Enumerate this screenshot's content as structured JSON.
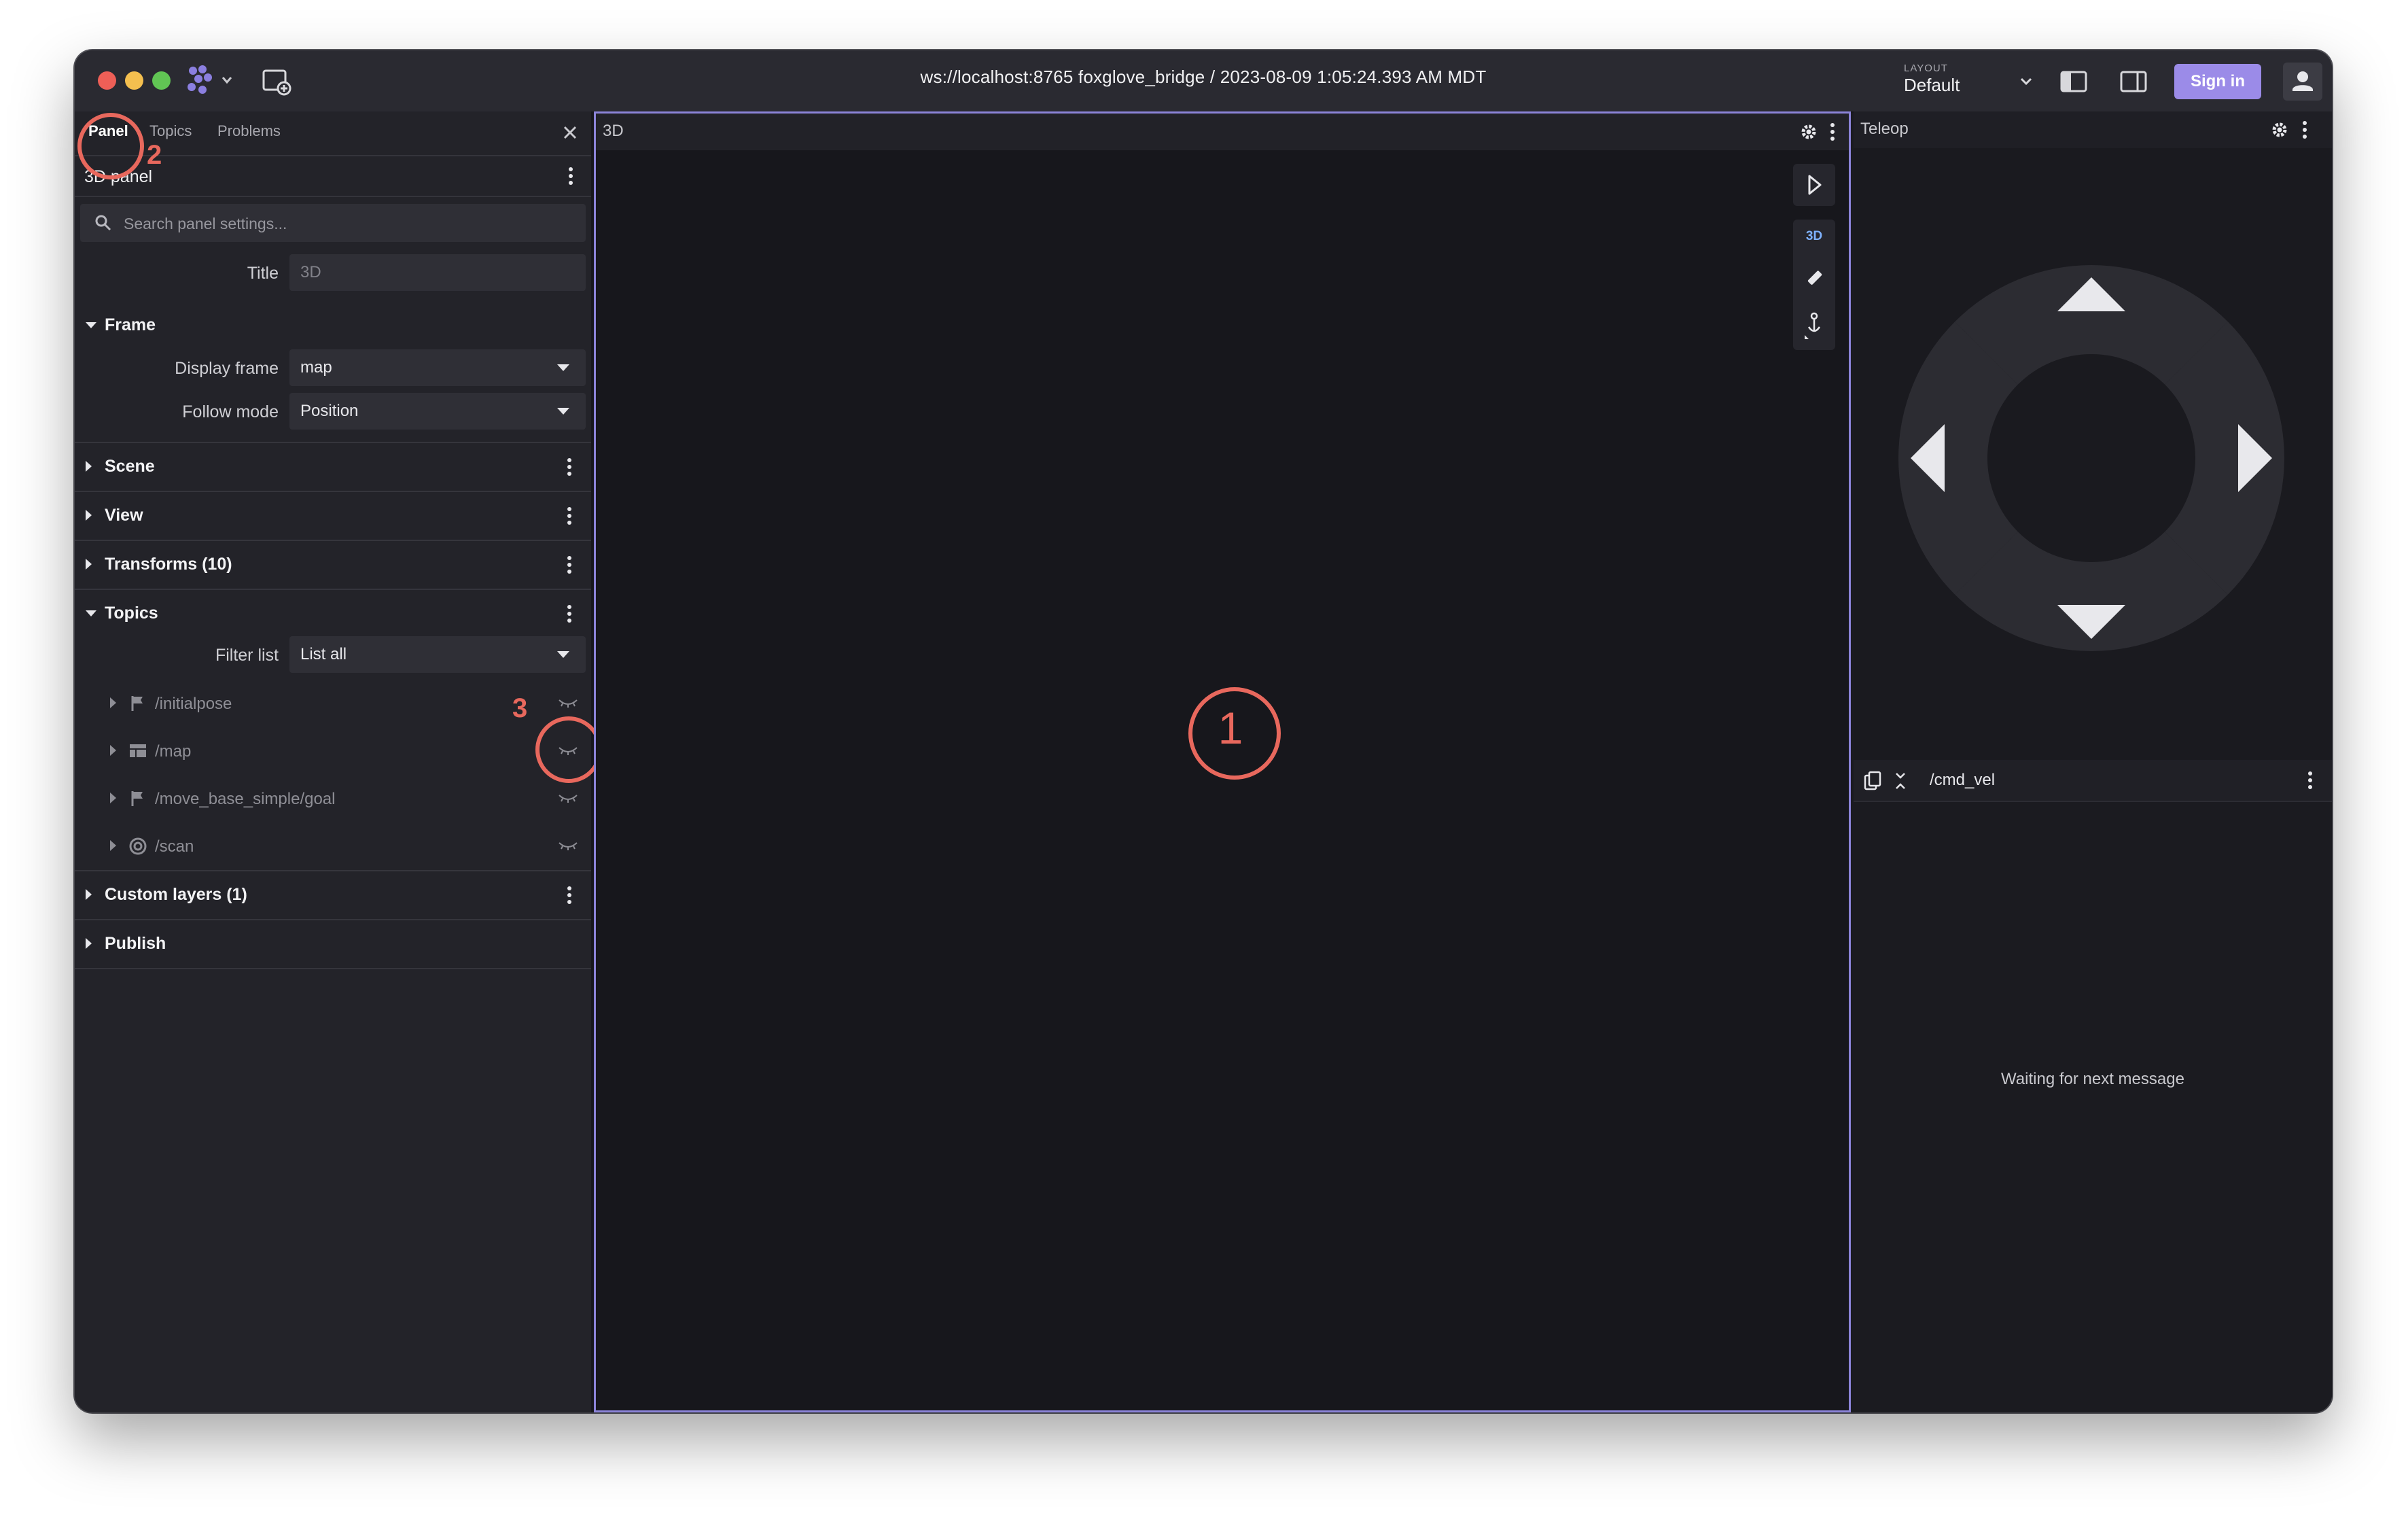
{
  "titlebar": {
    "connection": "ws://localhost:8765 foxglove_bridge / 2023-08-09 1:05:24.393 AM MDT",
    "layout_label": "LAYOUT",
    "layout_value": "Default",
    "signin_label": "Sign in"
  },
  "sidebar": {
    "tabs": [
      "Panel",
      "Topics",
      "Problems"
    ],
    "panel_name": "3D panel",
    "search_placeholder": "Search panel settings...",
    "title_field": {
      "label": "Title",
      "value": "3D"
    },
    "frame_section": {
      "label": "Frame",
      "display_frame": {
        "label": "Display frame",
        "value": "map"
      },
      "follow_mode": {
        "label": "Follow mode",
        "value": "Position"
      }
    },
    "sections": [
      "Scene",
      "View",
      "Transforms (10)",
      "Topics",
      "Custom layers (1)",
      "Publish"
    ],
    "filter_list": {
      "label": "Filter list",
      "value": "List all"
    },
    "topics": [
      {
        "name": "/initialpose",
        "icon": "flag-icon"
      },
      {
        "name": "/map",
        "icon": "grid-icon"
      },
      {
        "name": "/move_base_simple/goal",
        "icon": "flag-icon"
      },
      {
        "name": "/scan",
        "icon": "scan-icon"
      }
    ]
  },
  "panel3d": {
    "title": "3D",
    "mode_label": "3D"
  },
  "teleop": {
    "title": "Teleop"
  },
  "cmdvel": {
    "topic": "/cmd_vel",
    "status": "Waiting for next message"
  },
  "annotations": {
    "one": "1",
    "two": "2",
    "three": "3"
  },
  "colors": {
    "accent": "#9b8be8",
    "annotation": "#e8685d",
    "panel_border": "#8c84d9"
  }
}
